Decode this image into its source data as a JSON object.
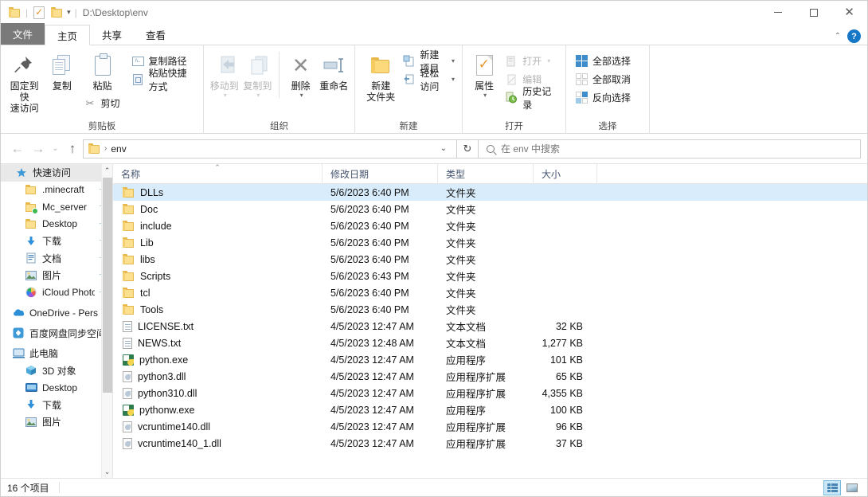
{
  "titlebar": {
    "path": "D:\\Desktop\\env",
    "qat": [
      {
        "name": "folder-icon",
        "label": ""
      },
      {
        "name": "properties-icon",
        "label": ""
      },
      {
        "name": "new-folder-icon",
        "label": ""
      },
      {
        "name": "customize-qat-caret",
        "label": "▾"
      }
    ],
    "minimize": "—",
    "maximize": "□",
    "close": "✕"
  },
  "tabs": [
    {
      "id": "file",
      "label": "文件"
    },
    {
      "id": "home",
      "label": "主页"
    },
    {
      "id": "share",
      "label": "共享"
    },
    {
      "id": "view",
      "label": "查看"
    }
  ],
  "tab_right": {
    "collapse_caret": "⌃",
    "help": "?"
  },
  "ribbon": {
    "groups": [
      {
        "id": "clipboard",
        "label": "剪贴板",
        "big": [
          {
            "id": "pin-to-quick-access",
            "icon": "pin-icon",
            "label": "固定到快\n速访问"
          },
          {
            "id": "copy",
            "icon": "copy-icon",
            "label": "复制"
          },
          {
            "id": "paste",
            "icon": "paste-icon",
            "label": "粘贴"
          }
        ],
        "small": [
          {
            "id": "copy-path",
            "icon": "copy-path-icon",
            "label": "复制路径"
          },
          {
            "id": "paste-shortcut",
            "icon": "paste-shortcut-icon",
            "label": "粘贴快捷方式"
          },
          {
            "id": "cut",
            "icon": "scissors-icon",
            "label": "剪切"
          }
        ]
      },
      {
        "id": "organize",
        "label": "组织",
        "big": [
          {
            "id": "move-to",
            "icon": "move-to-icon",
            "label": "移动到",
            "dim": true,
            "caret": "▾"
          },
          {
            "id": "copy-to",
            "icon": "copy-to-icon",
            "label": "复制到",
            "dim": true,
            "caret": "▾"
          },
          {
            "id": "delete",
            "icon": "delete-icon",
            "label": "删除",
            "caret": "▾"
          },
          {
            "id": "rename",
            "icon": "rename-icon",
            "label": "重命名"
          }
        ]
      },
      {
        "id": "new",
        "label": "新建",
        "big": [
          {
            "id": "new-folder",
            "icon": "new-folder-icon",
            "label": "新建\n文件夹"
          }
        ],
        "small": [
          {
            "id": "new-item",
            "icon": "new-item-icon",
            "label": "新建项目",
            "caret": "▾"
          },
          {
            "id": "easy-access",
            "icon": "easy-access-icon",
            "label": "轻松访问",
            "caret": "▾"
          }
        ]
      },
      {
        "id": "open",
        "label": "打开",
        "big": [
          {
            "id": "properties",
            "icon": "properties-icon",
            "label": "属性",
            "caret": "▾"
          }
        ],
        "small": [
          {
            "id": "open",
            "icon": "open-icon",
            "label": "打开",
            "dim": true,
            "caret": "▾"
          },
          {
            "id": "edit",
            "icon": "edit-icon",
            "label": "编辑",
            "dim": true
          },
          {
            "id": "history",
            "icon": "history-icon",
            "label": "历史记录"
          }
        ]
      },
      {
        "id": "select",
        "label": "选择",
        "small": [
          {
            "id": "select-all",
            "icon": "select-all-icon",
            "label": "全部选择"
          },
          {
            "id": "select-none",
            "icon": "select-none-icon",
            "label": "全部取消"
          },
          {
            "id": "invert-selection",
            "icon": "invert-selection-icon",
            "label": "反向选择"
          }
        ]
      }
    ]
  },
  "addressbar": {
    "back": "←",
    "forward": "→",
    "recent_caret": "⌄",
    "up": "↑",
    "breadcrumb_icon": "folder-icon",
    "breadcrumb_sep": "›",
    "breadcrumb_text": "env",
    "history_caret": "⌄",
    "refresh": "↻",
    "search_placeholder": "在 env 中搜索"
  },
  "sidebar": {
    "items": [
      {
        "id": "quick-access",
        "label": "快速访问",
        "icon": "star-icon",
        "level": 0,
        "header": true
      },
      {
        "id": "minecraft",
        "label": ".minecraft",
        "icon": "folder-icon",
        "level": 1,
        "pinned": true
      },
      {
        "id": "mc-server",
        "label": "Mc_server",
        "icon": "folder-sync-icon",
        "level": 1,
        "pinned": true
      },
      {
        "id": "desktop",
        "label": "Desktop",
        "icon": "folder-icon",
        "level": 1,
        "pinned": true
      },
      {
        "id": "downloads",
        "label": "下载",
        "icon": "download-icon",
        "level": 1,
        "pinned": true
      },
      {
        "id": "documents",
        "label": "文档",
        "icon": "documents-icon",
        "level": 1,
        "pinned": true
      },
      {
        "id": "pictures",
        "label": "图片",
        "icon": "pictures-icon",
        "level": 1,
        "pinned": true
      },
      {
        "id": "icloud-photos",
        "label": "iCloud Photo",
        "icon": "icloud-photos-icon",
        "level": 1,
        "pinned": true
      },
      {
        "id": "onedrive",
        "label": "OneDrive - Pers",
        "icon": "onedrive-cloud-icon",
        "level": 0
      },
      {
        "id": "baidu-netdisk",
        "label": "百度网盘同步空间",
        "icon": "baidu-netdisk-icon",
        "level": 0
      },
      {
        "id": "this-pc",
        "label": "此电脑",
        "icon": "this-pc-icon",
        "level": 0
      },
      {
        "id": "3d-objects",
        "label": "3D 对象",
        "icon": "3d-objects-icon",
        "level": 1
      },
      {
        "id": "pc-desktop",
        "label": "Desktop",
        "icon": "desktop-icon",
        "level": 1
      },
      {
        "id": "pc-downloads",
        "label": "下载",
        "icon": "download-icon",
        "level": 1
      },
      {
        "id": "pc-pictures",
        "label": "图片",
        "icon": "pictures-icon",
        "level": 1
      }
    ],
    "scroll_up": "⌃",
    "scroll_down": "⌄"
  },
  "filelist": {
    "columns": [
      {
        "id": "name",
        "label": "名称",
        "sorted": true,
        "sort_caret": "⌃"
      },
      {
        "id": "date",
        "label": "修改日期"
      },
      {
        "id": "type",
        "label": "类型"
      },
      {
        "id": "size",
        "label": "大小"
      }
    ],
    "rows": [
      {
        "name": "DLLs",
        "date": "5/6/2023 6:40 PM",
        "type": "文件夹",
        "size": "",
        "icon": "folder-icon",
        "selected": true
      },
      {
        "name": "Doc",
        "date": "5/6/2023 6:40 PM",
        "type": "文件夹",
        "size": "",
        "icon": "folder-icon"
      },
      {
        "name": "include",
        "date": "5/6/2023 6:40 PM",
        "type": "文件夹",
        "size": "",
        "icon": "folder-icon"
      },
      {
        "name": "Lib",
        "date": "5/6/2023 6:40 PM",
        "type": "文件夹",
        "size": "",
        "icon": "folder-icon"
      },
      {
        "name": "libs",
        "date": "5/6/2023 6:40 PM",
        "type": "文件夹",
        "size": "",
        "icon": "folder-icon"
      },
      {
        "name": "Scripts",
        "date": "5/6/2023 6:43 PM",
        "type": "文件夹",
        "size": "",
        "icon": "folder-icon"
      },
      {
        "name": "tcl",
        "date": "5/6/2023 6:40 PM",
        "type": "文件夹",
        "size": "",
        "icon": "folder-icon"
      },
      {
        "name": "Tools",
        "date": "5/6/2023 6:40 PM",
        "type": "文件夹",
        "size": "",
        "icon": "folder-icon"
      },
      {
        "name": "LICENSE.txt",
        "date": "4/5/2023 12:47 AM",
        "type": "文本文档",
        "size": "32 KB",
        "icon": "text-file-icon"
      },
      {
        "name": "NEWS.txt",
        "date": "4/5/2023 12:48 AM",
        "type": "文本文档",
        "size": "1,277 KB",
        "icon": "text-file-icon"
      },
      {
        "name": "python.exe",
        "date": "4/5/2023 12:47 AM",
        "type": "应用程序",
        "size": "101 KB",
        "icon": "python-exe-icon"
      },
      {
        "name": "python3.dll",
        "date": "4/5/2023 12:47 AM",
        "type": "应用程序扩展",
        "size": "65 KB",
        "icon": "dll-icon"
      },
      {
        "name": "python310.dll",
        "date": "4/5/2023 12:47 AM",
        "type": "应用程序扩展",
        "size": "4,355 KB",
        "icon": "dll-icon"
      },
      {
        "name": "pythonw.exe",
        "date": "4/5/2023 12:47 AM",
        "type": "应用程序",
        "size": "100 KB",
        "icon": "python-exe-icon"
      },
      {
        "name": "vcruntime140.dll",
        "date": "4/5/2023 12:47 AM",
        "type": "应用程序扩展",
        "size": "96 KB",
        "icon": "dll-icon"
      },
      {
        "name": "vcruntime140_1.dll",
        "date": "4/5/2023 12:47 AM",
        "type": "应用程序扩展",
        "size": "37 KB",
        "icon": "dll-icon"
      }
    ]
  },
  "statusbar": {
    "item_count": "16 个项目",
    "views": [
      {
        "id": "details-view",
        "selected": true
      },
      {
        "id": "large-icons-view",
        "selected": false
      }
    ]
  },
  "colors": {
    "selection": "#d9ecfb",
    "accent": "#1577c6",
    "folder": "#fcdf8f",
    "column_header_text": "#44546f"
  }
}
